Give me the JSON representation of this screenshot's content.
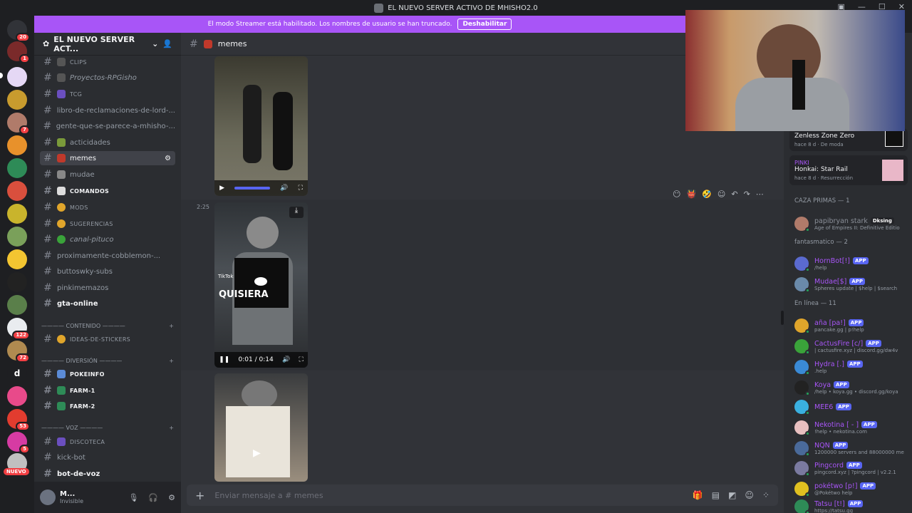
{
  "window": {
    "title": "EL NUEVO SERVER ACTIVO DE MHISHO2.0"
  },
  "banner": {
    "text": "El modo Streamer está habilitado. Los nombres de usuario se han truncado.",
    "button": "Deshabilitar"
  },
  "guilds": {
    "badges": [
      "20",
      "1",
      "7",
      "122",
      "72",
      "53",
      "5"
    ],
    "letter": "d",
    "nuevo": "NUEVO"
  },
  "server": {
    "name": "EL NUEVO SERVER ACT..."
  },
  "channels": [
    {
      "label": "CLIPS"
    },
    {
      "label": "Proyectos-RPGisho"
    },
    {
      "label": "TCG"
    },
    {
      "label": "libro-de-reclamaciones-de-lord-..."
    },
    {
      "label": "gente-que-se-parece-a-mhisho-..."
    },
    {
      "label": "acticidades"
    },
    {
      "label": "memes"
    },
    {
      "label": "mudae"
    },
    {
      "label": "COMANDOS"
    },
    {
      "label": "MODS"
    },
    {
      "label": "SUGERENCIAS"
    },
    {
      "label": "canal-pituco"
    },
    {
      "label": "proximamente-cobblemon-..."
    },
    {
      "label": "buttoswky-subs"
    },
    {
      "label": "pinkimemazos"
    },
    {
      "label": "gta-online"
    },
    {
      "label": "IDEAS-DE-STICKERS"
    },
    {
      "label": "POKEINFO"
    },
    {
      "label": "FARM-1"
    },
    {
      "label": "FARM-2"
    },
    {
      "label": "DISCOTECA"
    },
    {
      "label": "kick-bot"
    },
    {
      "label": "bot-de-voz"
    }
  ],
  "categories": [
    "———— CONTENIDO ————",
    "———— DIVERSIÓN ————",
    "———— VOZ ————"
  ],
  "user": {
    "name": "M...",
    "status": "Invisible"
  },
  "channel_header": {
    "name": "memes"
  },
  "message": {
    "time": "2:25",
    "video_overlay": "QUISIERA",
    "video_time": "0:01 / 0:14",
    "tiktok": "TikTok"
  },
  "composer": {
    "placeholder": "Enviar mensaje a # ",
    "channel": "memes"
  },
  "activity_cards": [
    {
      "title": "Zenless Zone Zero",
      "meta": "hace 8 d",
      "tag": "De moda"
    },
    {
      "user": "PINKI",
      "title": "Honkai: Star Rail",
      "meta": "hace 8 d",
      "tag": "Resurrección"
    }
  ],
  "member_groups": [
    {
      "title": "CAZA PRIMAS — 1"
    },
    {
      "title": "fantasmatico — 2"
    },
    {
      "title": "En línea — 11"
    }
  ],
  "members": [
    {
      "name": "papibryan stark",
      "extra": "Dksing",
      "status": "Age of Empires II: Definitive Editio",
      "color": "#8a8f98",
      "app": false
    },
    {
      "name": "HornBot[!]",
      "status": "/help",
      "color": "#a855f7",
      "app": true
    },
    {
      "name": "Mudae[$]",
      "status": "Spheres update | $help | $search",
      "color": "#a855f7",
      "app": true
    },
    {
      "name": "aña [pa!]",
      "status": "pancake.gg | p!help",
      "color": "#a855f7",
      "app": true
    },
    {
      "name": "CactusFire [c/]",
      "status": "| cactusfire.xyz | discord.gg/dw4v",
      "color": "#a855f7",
      "app": true
    },
    {
      "name": "Hydra [.]",
      "status": ".help",
      "color": "#a855f7",
      "app": true
    },
    {
      "name": "Koya",
      "status": "/help • koya.gg • discord.gg/koya",
      "color": "#a855f7",
      "app": true
    },
    {
      "name": "MEE6",
      "status": "",
      "color": "#a855f7",
      "app": true
    },
    {
      "name": "Nekotina [ - ]",
      "status": "!help • nekotina.com",
      "color": "#a855f7",
      "app": true
    },
    {
      "name": "NQN",
      "status": "1200000 servers and 88000000 me",
      "color": "#a855f7",
      "app": true
    },
    {
      "name": "Pingcord",
      "status": "pingcord.xyz | ?pingcord | v2.2.1",
      "color": "#a855f7",
      "app": true
    },
    {
      "name": "pokétwo [p!]",
      "status": "@Pokétwo help",
      "color": "#a855f7",
      "app": true
    },
    {
      "name": "Tatsu [t!]",
      "status": "https://tatsu.gg",
      "color": "#a855f7",
      "app": true
    }
  ],
  "app_tag": "APP",
  "colors": {
    "accent": "#a855f7",
    "blurple": "#5865f2",
    "red": "#f23f43",
    "online": "#23a55a"
  }
}
